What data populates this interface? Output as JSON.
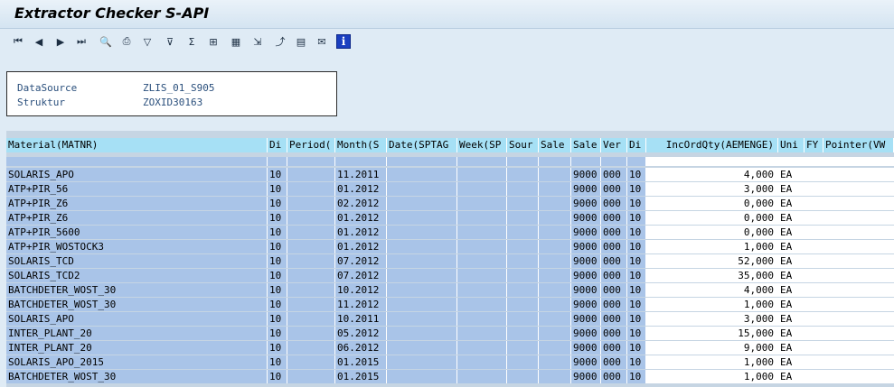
{
  "window": {
    "title": "Extractor Checker S-API"
  },
  "toolbar": {
    "icons": [
      "first-page-icon",
      "previous-page-icon",
      "next-page-icon",
      "last-page-icon",
      "details-icon",
      "print-icon",
      "filter-icon",
      "filter-set-icon",
      "sum-icon",
      "subtotal-icon",
      "layout-icon",
      "export-icon",
      "abc-analysis-icon",
      "spreadsheet-icon",
      "mail-icon",
      "info-icon"
    ]
  },
  "info": {
    "datasource_label": "DataSource",
    "datasource_value": "ZLIS_01_S905",
    "struktur_label": "Struktur",
    "struktur_value": "ZOXID30163"
  },
  "table": {
    "headers": [
      "Material(MATNR)",
      "Di",
      "Period(",
      "Month(S",
      "Date(SPTAG",
      "Week(SP",
      "Sour",
      "Sale",
      "Sale",
      "Ver",
      "Di",
      "IncOrdQty(AEMENGE)",
      "Uni",
      "FY",
      "Pointer(VW"
    ],
    "rows": [
      [
        "SOLARIS_APO",
        "10",
        "",
        "11.2011",
        "",
        "",
        "",
        "",
        "9000",
        "000",
        "10",
        "4,000",
        "EA",
        "",
        ""
      ],
      [
        "ATP+PIR_56",
        "10",
        "",
        "01.2012",
        "",
        "",
        "",
        "",
        "9000",
        "000",
        "10",
        "3,000",
        "EA",
        "",
        ""
      ],
      [
        "ATP+PIR_Z6",
        "10",
        "",
        "02.2012",
        "",
        "",
        "",
        "",
        "9000",
        "000",
        "10",
        "0,000",
        "EA",
        "",
        ""
      ],
      [
        "ATP+PIR_Z6",
        "10",
        "",
        "01.2012",
        "",
        "",
        "",
        "",
        "9000",
        "000",
        "10",
        "0,000",
        "EA",
        "",
        ""
      ],
      [
        "ATP+PIR_5600",
        "10",
        "",
        "01.2012",
        "",
        "",
        "",
        "",
        "9000",
        "000",
        "10",
        "0,000",
        "EA",
        "",
        ""
      ],
      [
        "ATP+PIR_WOSTOCK3",
        "10",
        "",
        "01.2012",
        "",
        "",
        "",
        "",
        "9000",
        "000",
        "10",
        "1,000",
        "EA",
        "",
        ""
      ],
      [
        "SOLARIS_TCD",
        "10",
        "",
        "07.2012",
        "",
        "",
        "",
        "",
        "9000",
        "000",
        "10",
        "52,000",
        "EA",
        "",
        ""
      ],
      [
        "SOLARIS_TCD2",
        "10",
        "",
        "07.2012",
        "",
        "",
        "",
        "",
        "9000",
        "000",
        "10",
        "35,000",
        "EA",
        "",
        ""
      ],
      [
        "BATCHDETER_WOST_30",
        "10",
        "",
        "10.2012",
        "",
        "",
        "",
        "",
        "9000",
        "000",
        "10",
        "4,000",
        "EA",
        "",
        ""
      ],
      [
        "BATCHDETER_WOST_30",
        "10",
        "",
        "11.2012",
        "",
        "",
        "",
        "",
        "9000",
        "000",
        "10",
        "1,000",
        "EA",
        "",
        ""
      ],
      [
        "SOLARIS_APO",
        "10",
        "",
        "10.2011",
        "",
        "",
        "",
        "",
        "9000",
        "000",
        "10",
        "3,000",
        "EA",
        "",
        ""
      ],
      [
        "INTER_PLANT_20",
        "10",
        "",
        "05.2012",
        "",
        "",
        "",
        "",
        "9000",
        "000",
        "10",
        "15,000",
        "EA",
        "",
        ""
      ],
      [
        "INTER_PLANT_20",
        "10",
        "",
        "06.2012",
        "",
        "",
        "",
        "",
        "9000",
        "000",
        "10",
        "9,000",
        "EA",
        "",
        ""
      ],
      [
        "SOLARIS_APO_2015",
        "10",
        "",
        "01.2015",
        "",
        "",
        "",
        "",
        "9000",
        "000",
        "10",
        "1,000",
        "EA",
        "",
        ""
      ],
      [
        "BATCHDETER_WOST_30",
        "10",
        "",
        "01.2015",
        "",
        "",
        "",
        "",
        "9000",
        "000",
        "10",
        "1,000",
        "EA",
        "",
        ""
      ]
    ]
  },
  "colors": {
    "header_bg": "#a6e0f5",
    "selected_bg": "#a9c4e8",
    "background": "#dfebf5"
  }
}
